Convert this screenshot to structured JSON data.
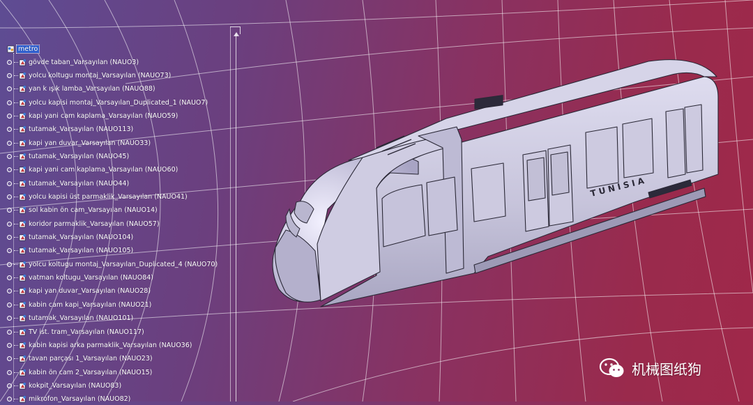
{
  "tree": {
    "root_label": "metro",
    "items": [
      "gövde taban_Varsayılan (NAUO3)",
      "yolcu koltugu montaj_Varsayılan (NAUO73)",
      "yan k    ışık lamba_Varsayılan (NAUO88)",
      "yolcu kapisi montaj_Varsayılan_Duplicated_1 (NAUO7)",
      "kapi yani cam kaplama_Varsayılan (NAUO59)",
      "tutamak_Varsayılan (NAUO113)",
      "kapi yan duvar_Varsayılan (NAUO33)",
      "tutamak_Varsayılan (NAUO45)",
      "kapi yani cam kaplama_Varsayılan (NAUO60)",
      "tutamak_Varsayılan (NAUO44)",
      "yolcu kapisi üst parmaklik_Varsayılan (NAUO41)",
      "sol kabin ön cam_Varsayılan (NAUO14)",
      "koridor parmaklik_Varsayılan (NAUO57)",
      "tutamak_Varsayılan (NAUO104)",
      "tutamak_Varsayılan (NAUO105)",
      "yolcu koltugu montaj_Varsayılan_Duplicated_4 (NAUO70)",
      "vatman koltugu_Varsayılan (NAUO84)",
      "kapi yan duvar_Varsayılan (NAUO28)",
      "kabin cam kapi_Varsayılan (NAUO21)",
      "tutamak_Varsayılan (NAUO101)",
      "TV ist. tram_Varsayılan (NAUO117)",
      "kabin kapisi arka parmaklik_Varsayılan (NAUO36)",
      "tavan parçası 1_Varsayılan (NAUO23)",
      "kabin ön cam 2_Varsayılan (NAUO15)",
      "kokpit_Varsayılan (NAUO83)",
      "mikrofon_Varsayılan (NAUO82)"
    ]
  },
  "model": {
    "side_text": "TUNISIA"
  },
  "watermark": {
    "text": "机械图纸狗",
    "icon": "wechat-icon"
  },
  "colors": {
    "selection": "#2f5fcf",
    "tree_text": "#ffffff",
    "model_body": "#c9c6dc"
  }
}
